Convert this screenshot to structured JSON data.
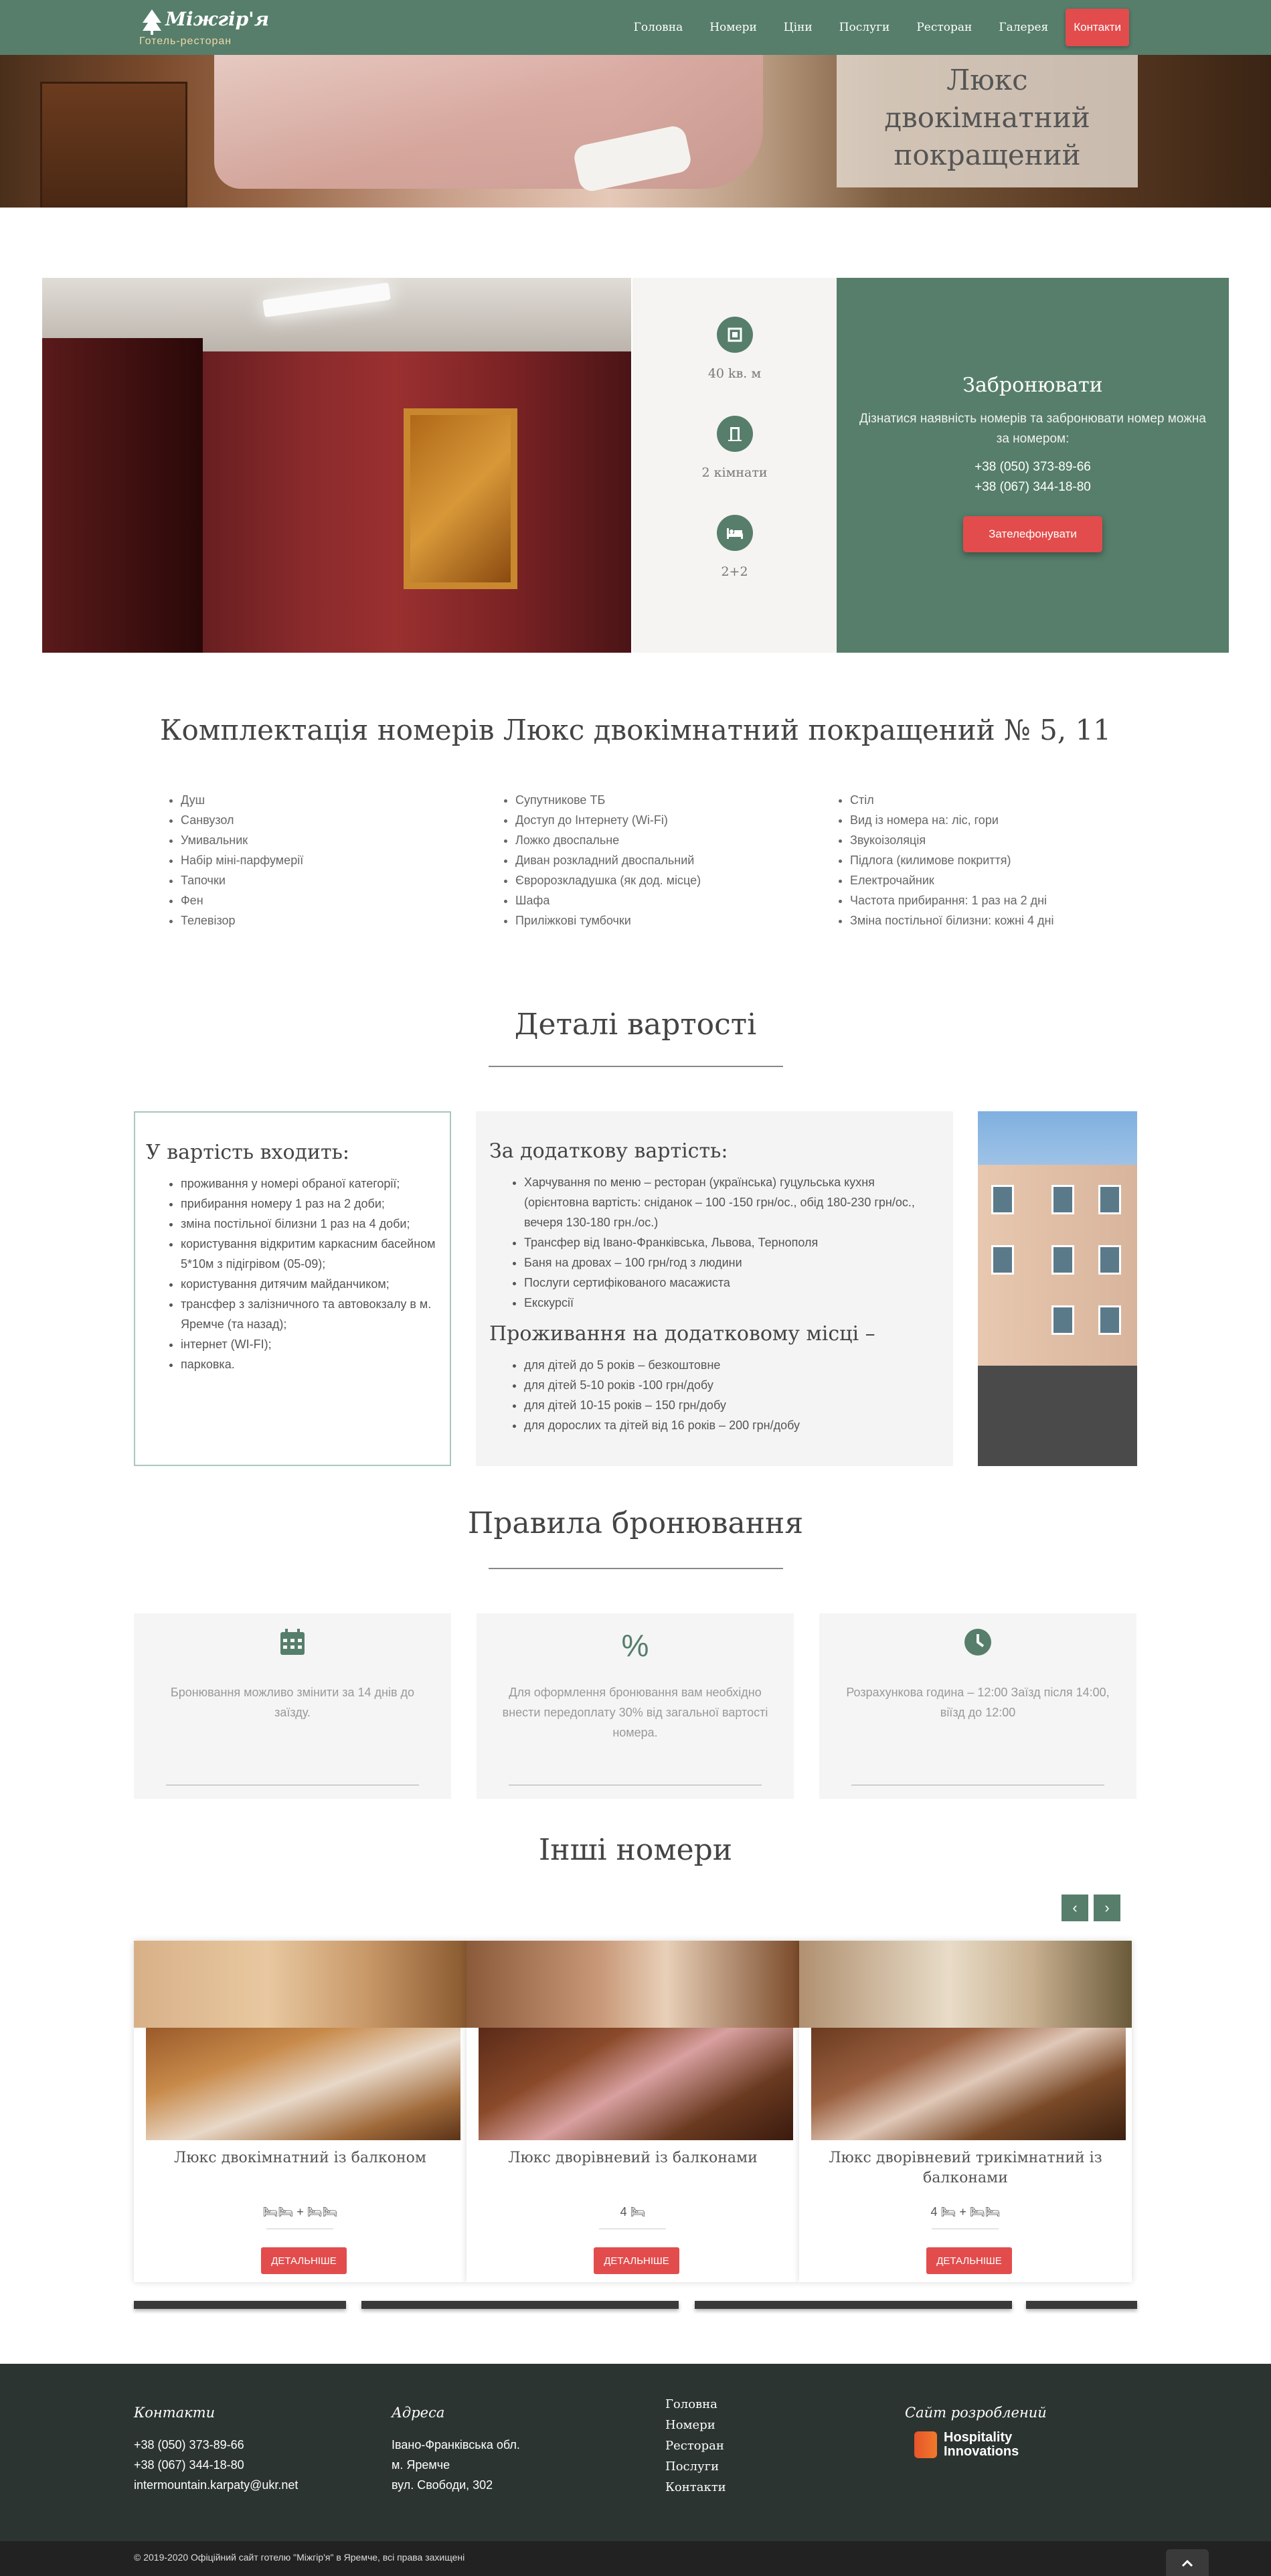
{
  "header": {
    "logo_name": "Міжгір'я",
    "logo_sub": "Готель-ресторан",
    "nav": [
      "Головна",
      "Номери",
      "Ціни",
      "Послуги",
      "Ресторан",
      "Галерея"
    ],
    "cta": "Контакти"
  },
  "hero": {
    "title": "Люкс двокімнатний покращений"
  },
  "facts": [
    {
      "icon": "area-icon",
      "text": "40 kв. м"
    },
    {
      "icon": "door-icon",
      "text": "2 кімнати"
    },
    {
      "icon": "bed-icon",
      "text": "2+2"
    }
  ],
  "booking": {
    "title": "Забронювати",
    "desc": "Дізнатися наявність номерів та забронювати номер можна за номером:",
    "phone1": "+38 (050) 373-89-66",
    "phone2": "+38 (067) 344-18-80",
    "button": "Зателефонувати"
  },
  "equipment": {
    "title": "Комплектація номерів Люкс двокімнатний покращений № 5, 11",
    "col1": [
      "Душ",
      "Санвузол",
      "Умивальник",
      "Набір міні-парфумерії",
      "Тапочки",
      "Фен",
      "Телевізор"
    ],
    "col2": [
      "Супутникове ТБ",
      "Доступ до Інтернету (Wi-Fi)",
      "Ложко двоспальне",
      "Диван розкладний двоспальний",
      "Євророзкладушка (як дод. місце)",
      "Шафа",
      "Приліжкові тумбочки"
    ],
    "col3": [
      "Стіл",
      "Вид із номера на: ліс, гори",
      "Звукоізоляція",
      "Підлога (килимове покриття)",
      "Електрочайник",
      "Частота прибирання: 1 раз на 2 дні",
      "Зміна постільної білизни: кожні 4 дні"
    ]
  },
  "price": {
    "title": "Деталі вартості",
    "included_title": "У вартість входить:",
    "included": [
      "проживання у номері обраної категорії;",
      "прибирання номеру 1 раз на 2 доби;",
      "зміна постільної білизни 1 раз на 4 доби;",
      "користування відкритим каркасним басейном 5*10м з підігрівом (05-09);",
      "користування дитячим майданчиком;",
      "трансфер з залізничного та автовокзалу в м. Яремче (та назад);",
      "інтернет (WI-FI);",
      "парковка."
    ],
    "extra_title": "За додаткову вартість:",
    "extra": [
      "Харчування по меню – ресторан (українська) гуцульська кухня (орієнтовна вартість: сніданок –  100 -150 грн/ос., обід 180-230 грн/ос., вечеря 130-180 грн./ос.)",
      "Трансфер від Івано-Франківська, Львова, Тернополя",
      "Баня на дровах – 100 грн/год з людини",
      "Послуги сертифікованого масажиста",
      "Екскурсії"
    ],
    "extra_bed_title": "Проживання на додатковому місці –",
    "extra_bed": [
      "для дітей до 5 років – безкоштовне",
      "для дітей 5-10 років -100 грн/добу",
      "для дітей 10-15 років – 150 грн/добу",
      "для дорослих та дітей від 16 років – 200 грн/добу"
    ]
  },
  "rules": {
    "title": "Правила бронювання",
    "cards": [
      {
        "icon": "calendar-icon",
        "text": "Бронювання можливо змінити за 14 днів до заїзду."
      },
      {
        "icon": "percent-icon",
        "text": "Для оформлення бронювання вам необхідно внести передоплату 30% від загальної вартості номера."
      },
      {
        "icon": "clock-icon",
        "text": "Розрахункова година – 12:00 Заїзд після 14:00, віїзд до 12:00"
      }
    ]
  },
  "others": {
    "title": "Інші номери",
    "prev": "‹",
    "next": "›",
    "cards": [
      {
        "name": "Люкс двокімнатний із балконом",
        "capacity": "🛏🛏 + 🛏🛏",
        "button": "ДЕТАЛЬНІШЕ"
      },
      {
        "name": "Люкс дворівневий із балконами",
        "capacity": "4 🛏",
        "button": "ДЕТАЛЬНІШЕ"
      },
      {
        "name": "Люкс дворівневий трикімнатний із балконами",
        "capacity": "4 🛏 + 🛏🛏",
        "button": "ДЕТАЛЬНІШЕ"
      }
    ]
  },
  "footer": {
    "contacts_title": "Контакти",
    "contacts": [
      "+38 (050) 373-89-66",
      "+38 (067) 344-18-80",
      "intermountain.karpaty@ukr.net"
    ],
    "address_title": "Адреса",
    "address": [
      "Івано-Франківська обл.",
      "м. Яремче",
      "вул. Свободи, 302"
    ],
    "nav": [
      "Головна",
      "Номери",
      "Ресторан",
      "Послуги",
      "Контакти"
    ],
    "dev_title": "Сайт розроблений",
    "dev_name1": "Hospitality",
    "dev_name2": "Innovations",
    "copyright": "© 2019-2020 Офіційний сайт готелю \"Міжгір'я\" в Яремче, всі права захищені"
  },
  "colors": {
    "accent": "#567e6b",
    "cta": "#e34c4c",
    "footer": "#2c3431"
  }
}
